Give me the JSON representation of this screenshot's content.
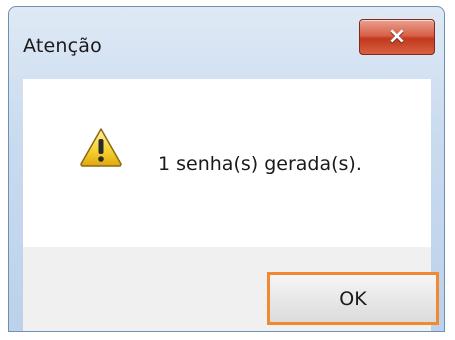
{
  "dialog": {
    "title": "Atenção",
    "message": "1 senha(s) gerada(s).",
    "close_icon": "×",
    "ok_label": "OK",
    "icon": "warning-icon"
  },
  "colors": {
    "highlight": "#f08a32",
    "close_button": "#c0391f",
    "footer_bg": "#f0f0f0"
  }
}
